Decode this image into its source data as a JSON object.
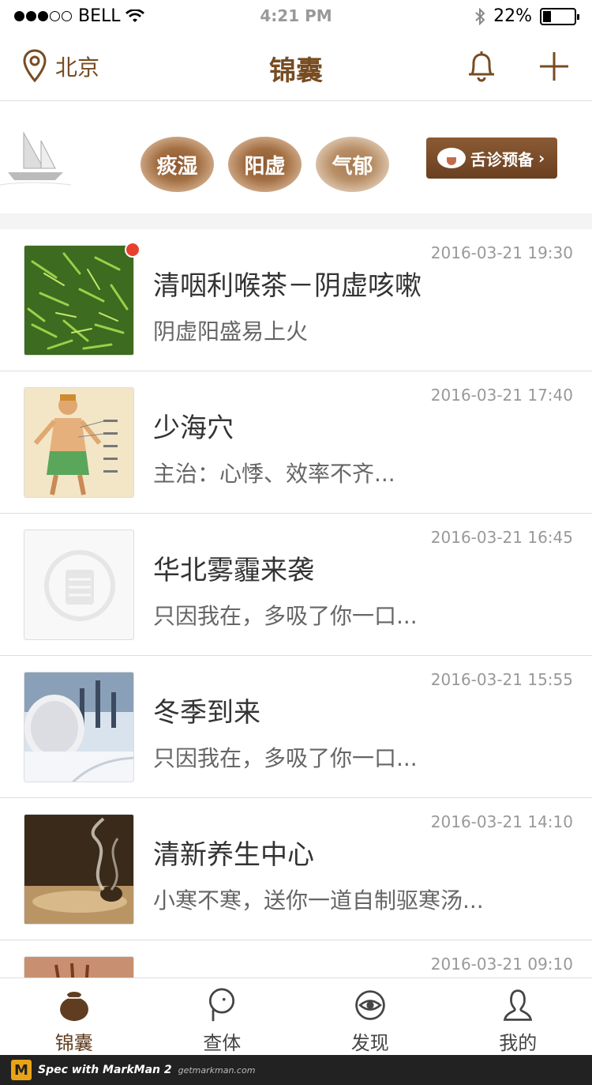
{
  "status_bar": {
    "carrier": "BELL",
    "time": "4:21 PM",
    "battery": "22%"
  },
  "nav": {
    "location": "北京",
    "title": "锦囊"
  },
  "banner": {
    "categories": [
      "痰湿",
      "阳虚",
      "气郁"
    ],
    "tongue_button": "舌诊预备"
  },
  "articles": [
    {
      "title": "清咽利喉茶－阴虚咳嗽",
      "subtitle": "阴虚阳盛易上火",
      "time": "2016-03-21 19:30",
      "thumb": "green-tea"
    },
    {
      "title": "少海穴",
      "subtitle": "主治：心悸、效率不齐...",
      "time": "2016-03-21 17:40",
      "thumb": "acupoint-figure"
    },
    {
      "title": "华北雾霾来袭",
      "subtitle": "只因我在，多吸了你一口...",
      "time": "2016-03-21 16:45",
      "thumb": "placeholder-logo"
    },
    {
      "title": "冬季到来",
      "subtitle": "只因我在，多吸了你一口...",
      "time": "2016-03-21 15:55",
      "thumb": "snow-tree"
    },
    {
      "title": "清新养生中心",
      "subtitle": "小寒不寒，送你一道自制驱寒汤...",
      "time": "2016-03-21 14:10",
      "thumb": "incense"
    },
    {
      "title": "",
      "subtitle": "",
      "time": "2016-03-21 09:10",
      "thumb": "partial"
    }
  ],
  "tabs": [
    {
      "label": "锦囊",
      "icon": "pouch-icon",
      "active": true
    },
    {
      "label": "查体",
      "icon": "body-check-icon",
      "active": false
    },
    {
      "label": "发现",
      "icon": "eye-icon",
      "active": false
    },
    {
      "label": "我的",
      "icon": "user-icon",
      "active": false
    }
  ],
  "footer": {
    "brand_text": "Spec with MarkMan 2",
    "site": "getmarkman.com"
  },
  "colors": {
    "brand": "#774c22",
    "tab_active": "#603d21",
    "tab_inactive": "#454545",
    "title": "#333333",
    "subtitle": "#666666",
    "time": "#999999",
    "divider": "#dddddd",
    "band": "#f4f4f4"
  }
}
